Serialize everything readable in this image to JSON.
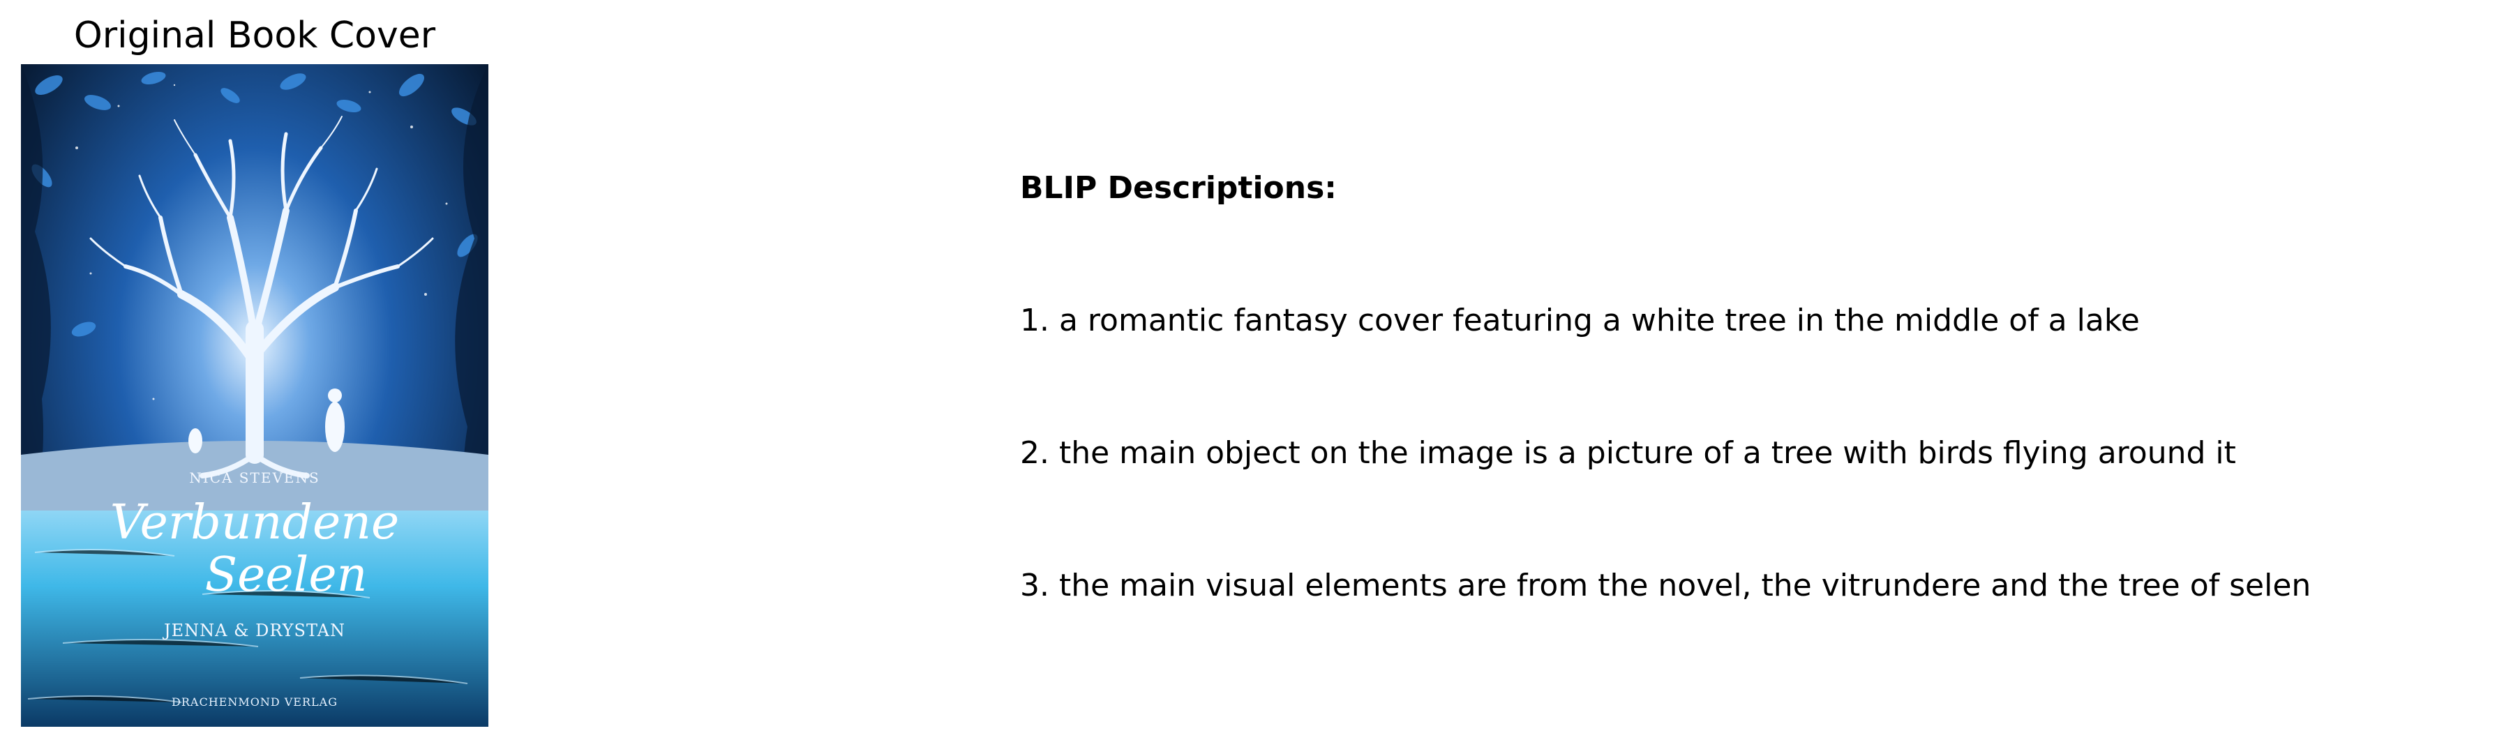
{
  "cover_panel": {
    "title": "Original Book Cover",
    "cover_text": {
      "author": "NICA STEVENS",
      "title_line_1": "Verbundene",
      "title_line_2": "Seelen",
      "subtitle": "JENNA & DRYSTAN",
      "publisher": "DRACHENMOND VERLAG"
    },
    "colors": {
      "background_dark": "#071a33",
      "background_blue": "#1f5fae",
      "glow": "#cfe6ff",
      "water": "#3fb8e8"
    }
  },
  "descriptions": {
    "heading": "BLIP Descriptions:",
    "items": [
      "1. a romantic fantasy cover featuring a white tree in the middle of a lake",
      "2. the main object on the image is a picture of a tree with birds flying around it",
      "3. the main visual elements are from the novel, the vitrundere and the tree of selen"
    ]
  }
}
